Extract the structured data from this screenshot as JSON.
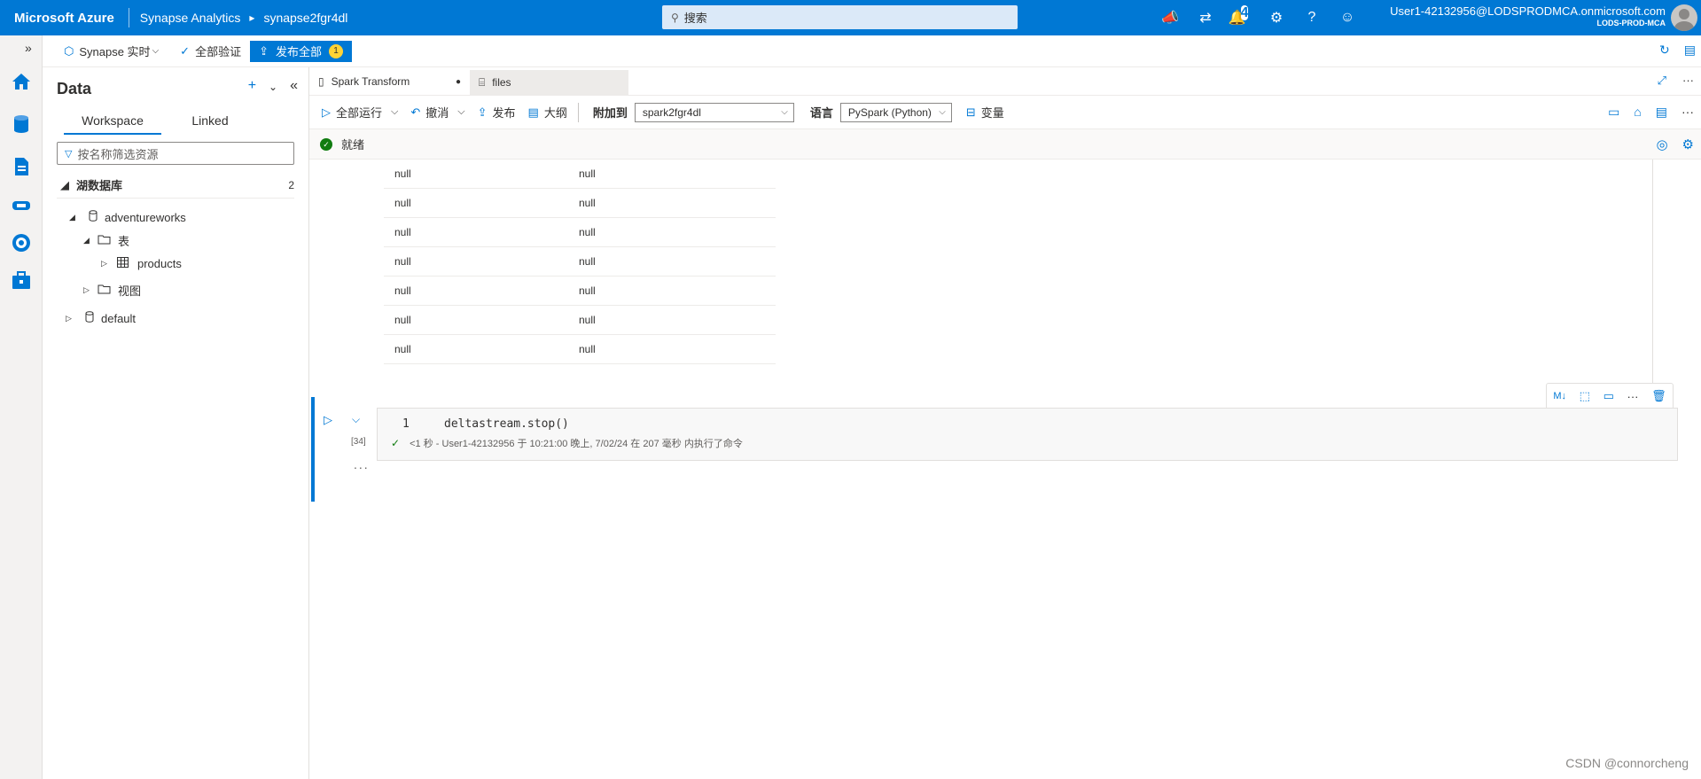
{
  "topbar": {
    "brand": "Microsoft Azure",
    "service": "Synapse Analytics",
    "workspace": "synapse2fgr4dl",
    "search_placeholder": "搜索",
    "notification_count": "4",
    "user_email": "User1-42132956@LODSPRODMCA.onmicrosoft.com",
    "tenant": "LODS-PROD-MCA"
  },
  "subbar": {
    "mode": "Synapse 实时",
    "validate_all": "全部验证",
    "publish_all": "发布全部",
    "publish_count": "1"
  },
  "data_panel": {
    "title": "Data",
    "tabs": [
      "Workspace",
      "Linked"
    ],
    "filter_placeholder": "按名称筛选资源",
    "section_label": "湖数据库",
    "section_count": "2",
    "tree": {
      "db1": "adventureworks",
      "tables": "表",
      "products": "products",
      "views": "视图",
      "db2": "default"
    }
  },
  "editor": {
    "tab1": "Spark Transform",
    "tab2": "files",
    "toolbar": {
      "run_all": "全部运行",
      "undo": "撤消",
      "publish": "发布",
      "outline": "大纲",
      "attach_label": "附加到",
      "attach_value": "spark2fgr4dl",
      "language_label": "语言",
      "language_value": "PySpark (Python)",
      "variables": "变量"
    },
    "status": "就绪",
    "output_rows": [
      [
        "null",
        "null"
      ],
      [
        "null",
        "null"
      ],
      [
        "null",
        "null"
      ],
      [
        "null",
        "null"
      ],
      [
        "null",
        "null"
      ],
      [
        "null",
        "null"
      ],
      [
        "null",
        "null"
      ]
    ],
    "cell": {
      "line_number": "1",
      "code": "deltastream.stop()",
      "exec_count": "[34]",
      "exec_info": "<1 秒 - User1-42132956 于 10:21:00 晚上, 7/02/24 在 207 毫秒 内执行了命令",
      "ellipsis": "..."
    },
    "cell_tools": {
      "markdown": "M↓"
    }
  },
  "watermark": "CSDN @connorcheng"
}
